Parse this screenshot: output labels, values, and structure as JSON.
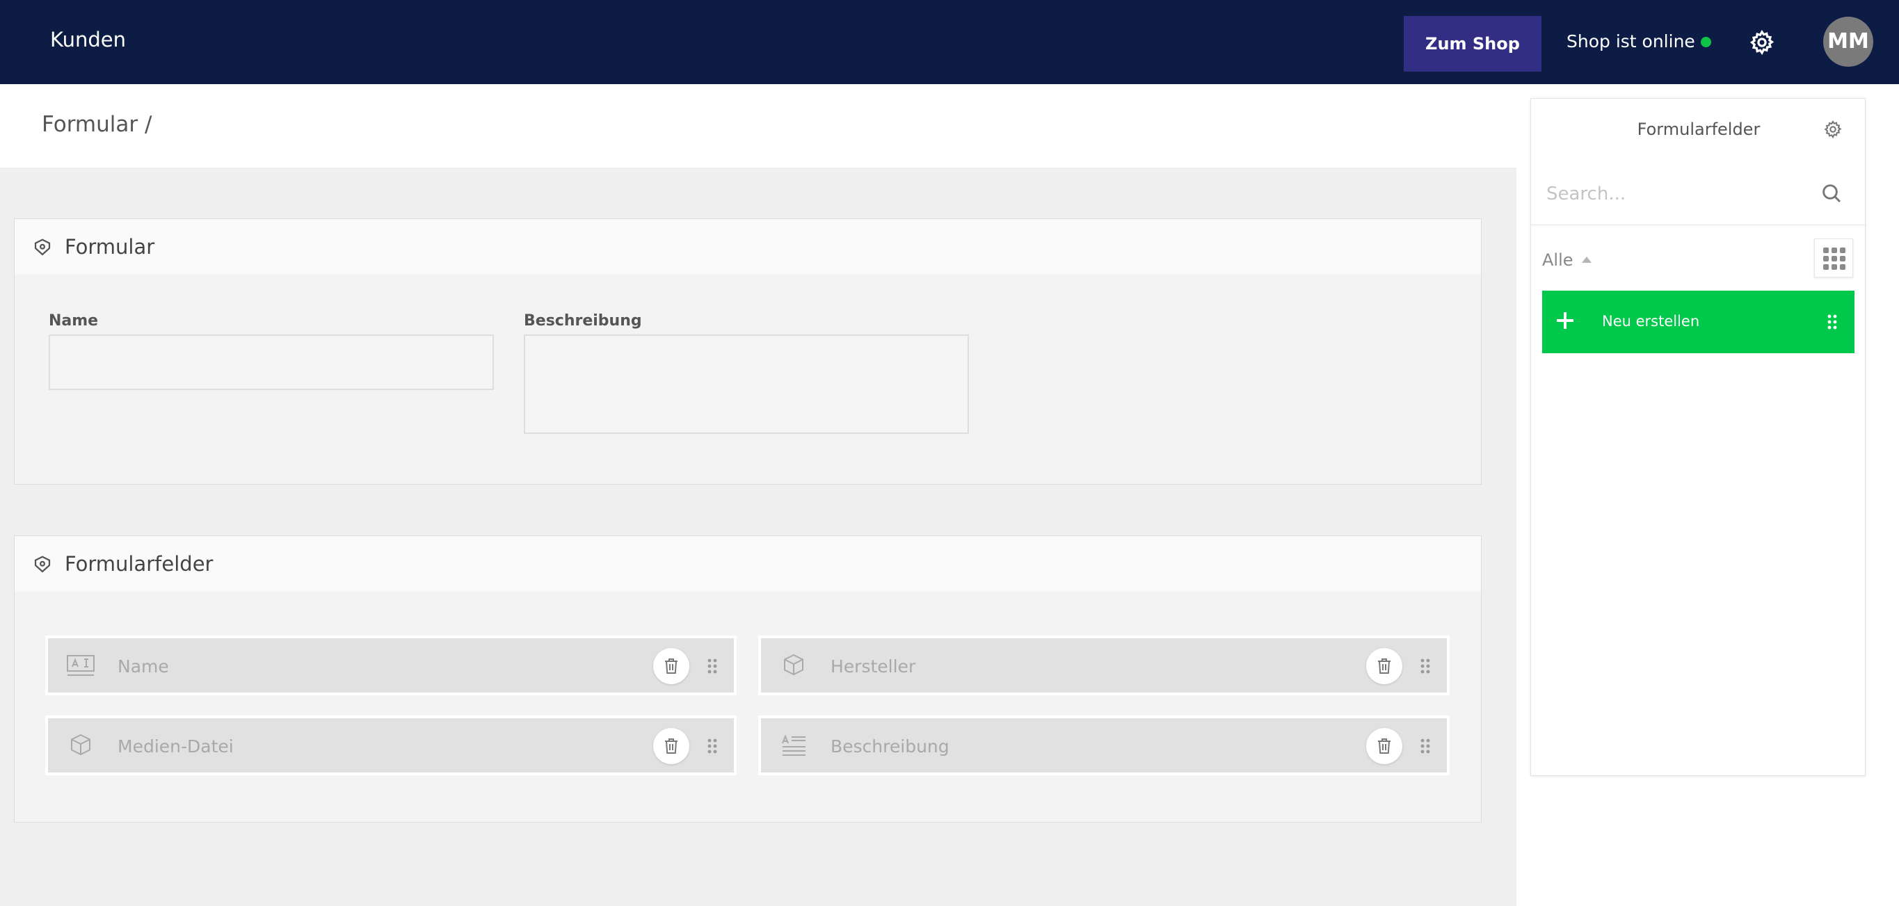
{
  "topbar": {
    "title": "Kunden",
    "shop_button": "Zum Shop",
    "status_text": "Shop ist online",
    "avatar_initials": "MM"
  },
  "colors": {
    "topbar": "#0c1c45",
    "shop_button": "#312e84",
    "online": "#0fc447",
    "create_button": "#00c84a"
  },
  "breadcrumb": "Formular /",
  "form_card": {
    "title": "Formular",
    "name_label": "Name",
    "description_label": "Beschreibung",
    "name_value": "",
    "description_value": ""
  },
  "fields_card": {
    "title": "Formularfelder",
    "items": [
      {
        "label": "Name",
        "icon": "text-field-icon"
      },
      {
        "label": "Hersteller",
        "icon": "cube-icon"
      },
      {
        "label": "Medien-Datei",
        "icon": "cube-icon"
      },
      {
        "label": "Beschreibung",
        "icon": "text-area-icon"
      }
    ]
  },
  "panel": {
    "title": "Formularfelder",
    "search_placeholder": "Search...",
    "filter": "Alle",
    "create_label": "Neu erstellen"
  }
}
